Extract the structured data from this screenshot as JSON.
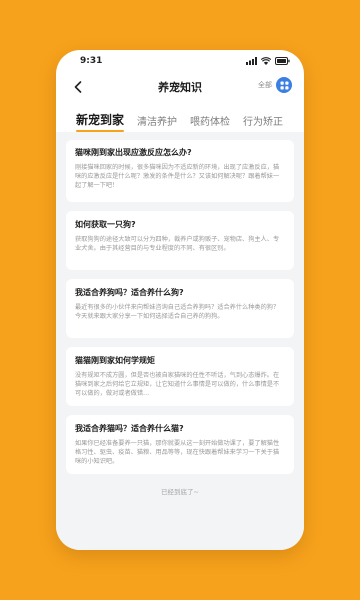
{
  "status_bar": {
    "time": "9:31"
  },
  "header": {
    "back_icon": "chevron-left-icon",
    "title": "养宠知识",
    "all_label": "全部",
    "menu_icon": "grid-icon"
  },
  "tabs": [
    {
      "label": "新宠到家",
      "active": true
    },
    {
      "label": "清洁养护",
      "active": false
    },
    {
      "label": "喂药体检",
      "active": false
    },
    {
      "label": "行为矫正",
      "active": false
    }
  ],
  "articles": [
    {
      "title": "猫咪刚到家出现应激反应怎么办?",
      "excerpt": "刚接猫咪回家的时候，很多猫咪因为不适应新的环境，出现了应激反应，猫咪的应激反应是什么呢？激发的条件是什么？又该如何解决呢？跟着帮妹一起了解一下吧！"
    },
    {
      "title": "如何获取一只狗?",
      "excerpt": "获取狗狗的途径大致可以分为四种，裁养户或狗贩子、宠物店、狗主人、专业犬舍。由于其经营目的与专业程度的不同、有很区别。"
    },
    {
      "title": "我适合养狗吗？适合养什么狗?",
      "excerpt": "最近有很多的小伙伴来向帮妹咨询自己适合养狗吗？适合养什么种类的狗？今天就来跟大家分享一下如何选择适合自己养的狗狗。"
    },
    {
      "title": "猫猫刚到家如何学规矩",
      "excerpt": "没有规矩不成方圆，但是否也被自家猫咪的任性不听话，气到心态爆炸。在猫咪到家之后何给它立规矩，让它知道什么事情是可以做的，什么事情是不可以做的，做对或者做错…"
    },
    {
      "title": "我适合养猫吗？适合养什么猫?",
      "excerpt": "如果你已经准备要养一只猫，那你就要从这一刻开始做功课了，要了解猫性格习性、驱虫、疫苗、猫粮、用品等等，现在快跟着帮妹来学习一下关于猫咪的小知识吧。"
    }
  ],
  "footer": {
    "text": "已经到底了~"
  }
}
